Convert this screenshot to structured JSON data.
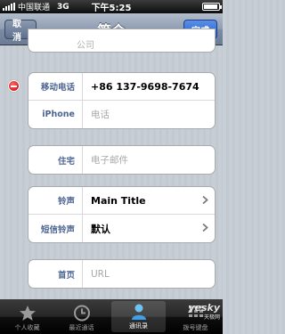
{
  "status_bar": {
    "carrier": "中国联通",
    "network": "3G",
    "time": "下午5:25"
  },
  "nav": {
    "title": "简介",
    "cancel_label": "取消",
    "done_label": "完成"
  },
  "company": {
    "placeholder": "公司"
  },
  "phones": [
    {
      "label": "移动电话",
      "value": "+86 137-9698-7674",
      "placeholder": false
    },
    {
      "label": "iPhone",
      "value": "电话",
      "placeholder": true
    }
  ],
  "address": {
    "label": "住宅",
    "value": "电子邮件",
    "placeholder": true
  },
  "ringtones": [
    {
      "label": "铃声",
      "value": "Main Title"
    },
    {
      "label": "短信铃声",
      "value": "默认"
    }
  ],
  "homepage": {
    "label": "首页",
    "value": "URL"
  },
  "tabs": [
    {
      "label": "个人收藏",
      "icon": "star-icon",
      "active": false
    },
    {
      "label": "最近通话",
      "icon": "clock-icon",
      "active": false
    },
    {
      "label": "通讯录",
      "icon": "contacts-icon",
      "active": true
    },
    {
      "label": "拨号键盘",
      "icon": "keypad-icon",
      "active": false
    }
  ],
  "watermark": {
    "main": "yesky",
    "sub": "天极网"
  },
  "colors": {
    "nav_bar": "#7d8da5",
    "done_button": "#2660cf",
    "label_text": "#4e6592",
    "delete_red": "#c80000"
  }
}
